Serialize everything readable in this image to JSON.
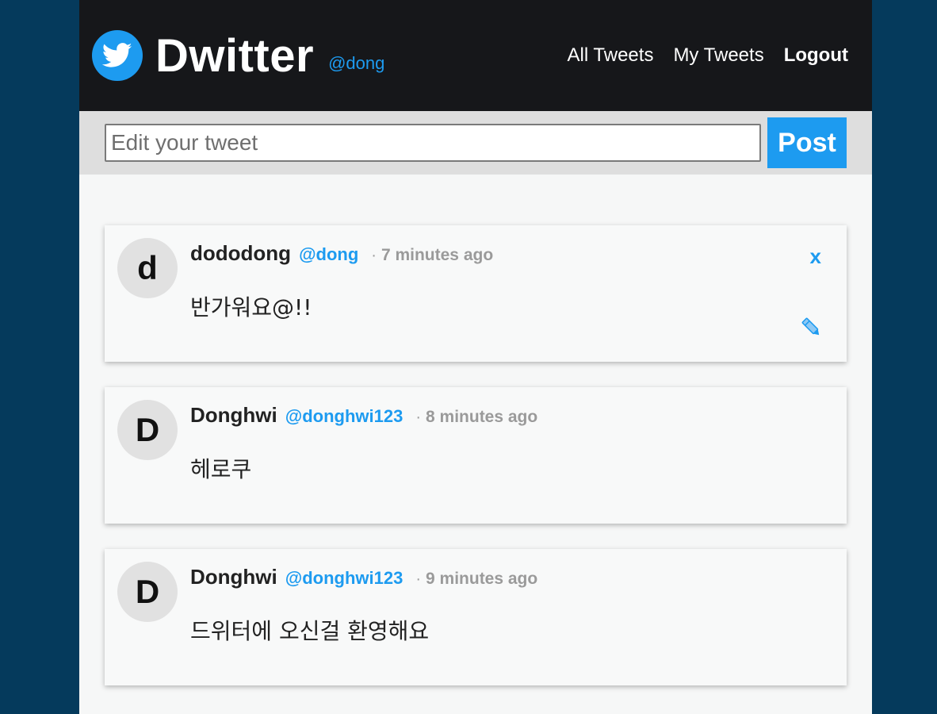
{
  "header": {
    "logo_icon": "twitter-bird-icon",
    "title": "Dwitter",
    "username": "@dong",
    "nav": {
      "all_tweets": "All Tweets",
      "my_tweets": "My Tweets",
      "logout": "Logout"
    }
  },
  "composer": {
    "placeholder": "Edit your tweet",
    "value": "",
    "post_label": "Post"
  },
  "tweets": [
    {
      "avatar_letter": "d",
      "name": "dododong",
      "handle": "@dong",
      "separator": "·",
      "time": "7 minutes ago",
      "text": "반가워요@!!",
      "delete_label": "x",
      "edit_icon": "pencil-icon"
    },
    {
      "avatar_letter": "D",
      "name": "Donghwi",
      "handle": "@donghwi123",
      "separator": "·",
      "time": "8 minutes ago",
      "text": "헤로쿠"
    },
    {
      "avatar_letter": "D",
      "name": "Donghwi",
      "handle": "@donghwi123",
      "separator": "·",
      "time": "9 minutes ago",
      "text": "드위터에 오신걸 환영해요"
    }
  ],
  "colors": {
    "page_background": "#053a5c",
    "header_background": "#16171a",
    "accent": "#1d9bf0",
    "composer_background": "#dedede",
    "card_background": "#f8f9f9"
  }
}
